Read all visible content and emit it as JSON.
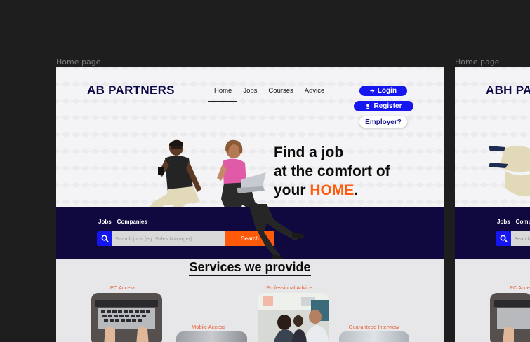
{
  "canvas": {
    "frames": [
      {
        "label": "Home page"
      },
      {
        "label": "Home page"
      }
    ]
  },
  "header": {
    "brand": "AB PARTNERS",
    "nav": [
      {
        "label": "Home",
        "active": true
      },
      {
        "label": "Jobs",
        "active": false
      },
      {
        "label": "Courses",
        "active": false
      },
      {
        "label": "Advice",
        "active": false
      }
    ],
    "login_label": "Login",
    "register_label": "Register",
    "employer_label": "Employer?"
  },
  "hero": {
    "line1": "Find a job",
    "line2": "at the comfort of",
    "line3_prefix": "your ",
    "line3_highlight": "HOME",
    "line3_suffix": "."
  },
  "search": {
    "tabs": [
      {
        "label": "Jobs",
        "active": true
      },
      {
        "label": "Companies",
        "active": false
      }
    ],
    "placeholder": "Search jobs (eg. Sales Manager)",
    "button_label": "Search"
  },
  "services": {
    "title": "Services we provide",
    "items": [
      {
        "label": "PC Access"
      },
      {
        "label": "Mobile Access"
      },
      {
        "label": "Professional Advice"
      },
      {
        "label": "Guaranteed Interview"
      }
    ]
  },
  "second_frame": {
    "brand": "ABH PA",
    "tabs": [
      "Jobs",
      "Comp"
    ],
    "placeholder": "Search",
    "service_label": "PC Acce"
  },
  "colors": {
    "canvas_bg": "#1e1e1e",
    "brand_navy": "#0d0a4a",
    "accent_blue": "#1616f0",
    "accent_orange": "#ff5a0a",
    "search_band": "#10093f"
  }
}
